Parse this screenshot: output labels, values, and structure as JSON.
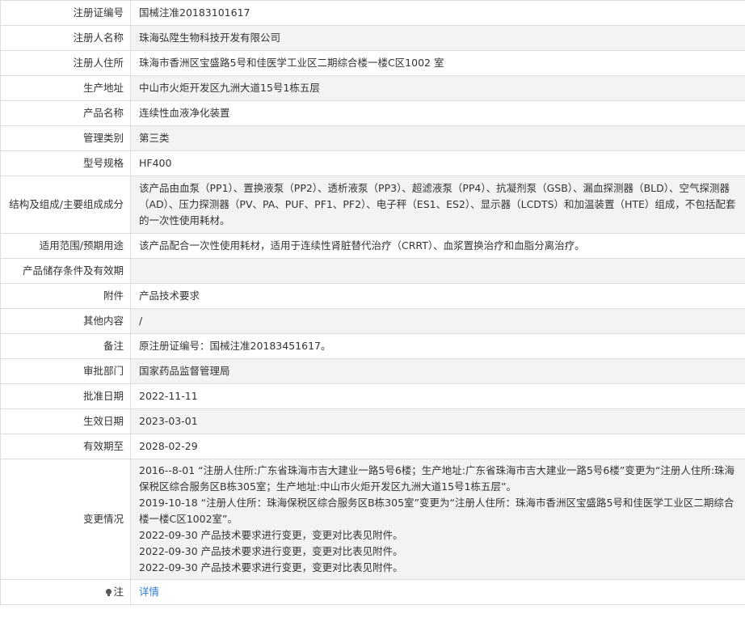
{
  "rows": [
    {
      "label": "注册证编号",
      "value": "国械注准20183101617"
    },
    {
      "label": "注册人名称",
      "value": "珠海弘陞生物科技开发有限公司"
    },
    {
      "label": "注册人住所",
      "value": "珠海市香洲区宝盛路5号和佳医学工业区二期综合楼一楼C区1002 室"
    },
    {
      "label": "生产地址",
      "value": "中山市火炬开发区九洲大道15号1栋五层"
    },
    {
      "label": "产品名称",
      "value": "连续性血液净化装置"
    },
    {
      "label": "管理类别",
      "value": "第三类"
    },
    {
      "label": "型号规格",
      "value": "HF400"
    },
    {
      "label": "结构及组成/主要组成成分",
      "value": "该产品由血泵（PP1）、置换液泵（PP2）、透析液泵（PP3）、超滤液泵（PP4）、抗凝剂泵（GSB）、漏血探测器（BLD）、空气探测器（AD）、压力探测器（PV、PA、PUF、PF1、PF2）、电子秤（ES1、ES2）、显示器（LCDTS）和加温装置（HTE）组成，不包括配套的一次性使用耗材。"
    },
    {
      "label": "适用范围/预期用途",
      "value": "该产品配合一次性使用耗材，适用于连续性肾脏替代治疗（CRRT）、血浆置换治疗和血脂分离治疗。"
    },
    {
      "label": "产品储存条件及有效期",
      "value": ""
    },
    {
      "label": "附件",
      "value": "产品技术要求"
    },
    {
      "label": "其他内容",
      "value": "/"
    },
    {
      "label": "备注",
      "value": "原注册证编号：国械注准20183451617。"
    },
    {
      "label": "审批部门",
      "value": "国家药品监督管理局"
    },
    {
      "label": "批准日期",
      "value": "2022-11-11"
    },
    {
      "label": "生效日期",
      "value": "2023-03-01"
    },
    {
      "label": "有效期至",
      "value": "2028-02-29"
    }
  ],
  "changes": {
    "label": "变更情况",
    "lines": [
      "2016--8-01 “注册人住所:广东省珠海市吉大建业一路5号6楼；生产地址:广东省珠海市吉大建业一路5号6楼”变更为“注册人住所:珠海保税区综合服务区B栋305室；生产地址:中山市火炬开发区九洲大道15号1栋五层”。",
      "2019-10-18 “注册人住所：珠海保税区综合服务区B栋305室”变更为“注册人住所：珠海市香洲区宝盛路5号和佳医学工业区二期综合楼一楼C区1002室”。",
      "2022-09-30 产品技术要求进行变更，变更对比表见附件。",
      "2022-09-30 产品技术要求进行变更，变更对比表见附件。",
      "2022-09-30 产品技术要求进行变更，变更对比表见附件。"
    ]
  },
  "note": {
    "icon": "lightbulb-icon",
    "label": "注",
    "link": "详情",
    "link_color": "#2f7ad1"
  }
}
